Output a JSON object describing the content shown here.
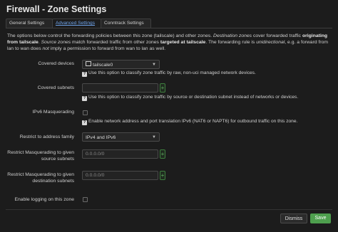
{
  "window": {
    "title": "Firewall - Zone Settings"
  },
  "tabs": [
    {
      "label": "General Settings",
      "active": false
    },
    {
      "label": "Advanced Settings",
      "active": true
    },
    {
      "label": "Conntrack Settings",
      "active": false
    }
  ],
  "description": {
    "p1": "The options below control the forwarding policies between this zone (tailscale) and other zones. ",
    "dest_zones": "Destination zones",
    "p2": " cover forwarded traffic ",
    "originating_from": "originating from tailscale",
    "p3": ". ",
    "source_zones": "Source zones",
    "p4": " match forwarded traffic from other zones ",
    "targeted_at": "targeted at tailscale",
    "p5": ". The forwarding rule is ",
    "unidirectional": "unidirectional",
    "p6": ", e.g. a forward from lan to wan does ",
    "not": "not",
    "p7": " imply a permission to forward from wan to lan as well."
  },
  "fields": {
    "covered_devices": {
      "label": "Covered devices",
      "value": "tailscale0",
      "help": "Use this option to classify zone traffic by raw, non-uci managed network devices."
    },
    "covered_subnets": {
      "label": "Covered subnets",
      "value": "",
      "help": "Use this option to classify zone traffic by source or destination subnet instead of networks or devices."
    },
    "ipv6_masquerading": {
      "label": "IPv6 Masquerading",
      "checked": false,
      "help": "Enable network address and port translation IPv6 (NAT6 or NAPT6) for outbound traffic on this zone."
    },
    "restrict_family": {
      "label": "Restrict to address family",
      "value": "IPv4 and IPv6"
    },
    "masq_src": {
      "label": "Restrict Masquerading to given source subnets",
      "placeholder": "0.0.0.0/0"
    },
    "masq_dest": {
      "label": "Restrict Masquerading to given destination subnets",
      "placeholder": "0.0.0.0/0"
    },
    "logging": {
      "label": "Enable logging on this zone",
      "checked": false
    }
  },
  "icons": {
    "add": "+",
    "help": "?"
  },
  "buttons": {
    "dismiss": "Dismiss",
    "save": "Save"
  },
  "colors": {
    "accent_blue": "#6ea3ea",
    "save_green": "#4e9f4e",
    "background": "#1c1c1c"
  }
}
